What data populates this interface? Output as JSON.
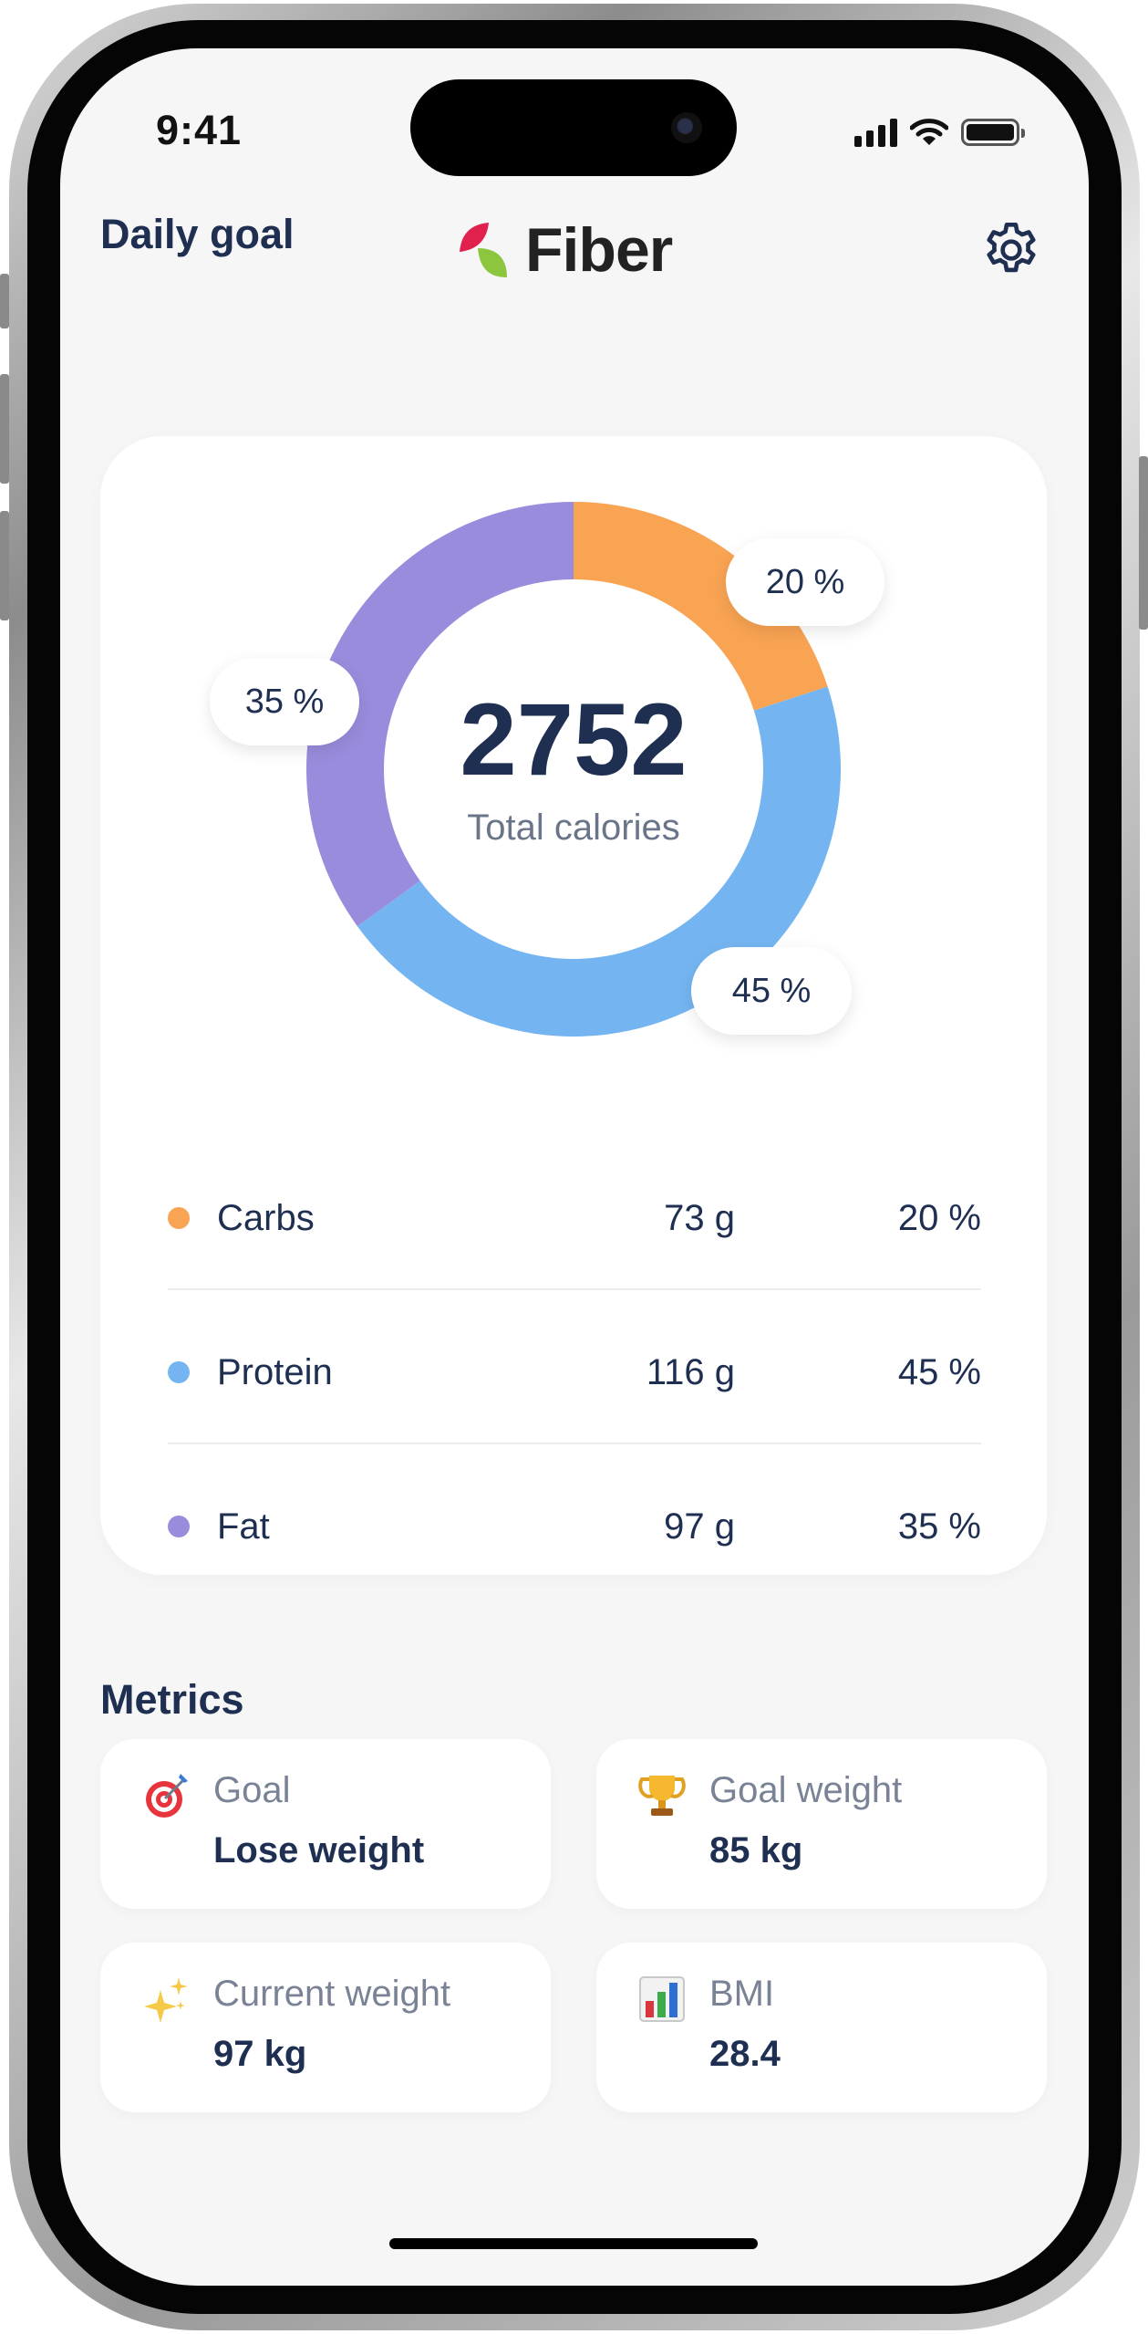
{
  "status_bar": {
    "time": "9:41"
  },
  "header": {
    "app_name": "Fiber"
  },
  "daily_goal": {
    "title": "Daily goal",
    "total_calories": "2752",
    "total_label": "Total calories",
    "macros": [
      {
        "name": "Carbs",
        "grams": "73 g",
        "percent": "20 %",
        "value": 20,
        "color": "#f9a453"
      },
      {
        "name": "Protein",
        "grams": "116 g",
        "percent": "45 %",
        "value": 45,
        "color": "#74b5f1"
      },
      {
        "name": "Fat",
        "grams": "97 g",
        "percent": "35 %",
        "value": 35,
        "color": "#9a8cdd"
      }
    ]
  },
  "metrics": {
    "title": "Metrics",
    "items": [
      {
        "label": "Goal",
        "value": "Lose weight",
        "icon": "target-icon"
      },
      {
        "label": "Goal weight",
        "value": "85 kg",
        "icon": "trophy-icon"
      },
      {
        "label": "Current weight",
        "value": "97 kg",
        "icon": "sparkles-icon"
      },
      {
        "label": "BMI",
        "value": "28.4",
        "icon": "bar-chart-icon"
      }
    ]
  }
}
